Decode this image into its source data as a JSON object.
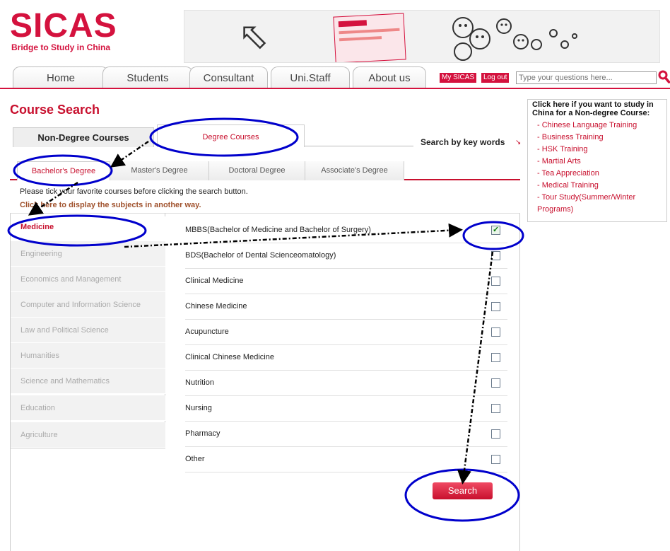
{
  "logo": {
    "name": "SICAS",
    "tagline": "Bridge to Study in China"
  },
  "colors": {
    "brand": "#d4123e",
    "accent": "#c8102e",
    "annotation": "#0000cc"
  },
  "nav": {
    "tabs": [
      "Home",
      "Students",
      "Consultant",
      "Uni.Staff",
      "About us"
    ],
    "my_sicas": "My SICAS",
    "log_out": "Log out",
    "search_placeholder": "Type your questions here...",
    "search_icon": "magnifier-icon"
  },
  "page_title": "Course Search",
  "course_tabs": {
    "non_degree": "Non-Degree Courses",
    "degree": "Degree Courses"
  },
  "search_by_keywords": "Search by key words",
  "degree_tabs": [
    "Bachelor's Degree",
    "Master's Degree",
    "Doctoral Degree",
    "Associate's Degree"
  ],
  "instructions": "Please tick your favorite courses before clicking the search button.",
  "click_here": "Click here to display the subjects in another way.",
  "subjects": [
    "Medicine",
    "Engineering",
    "Economics and Management",
    "Computer and Information Science",
    "Law and Political Science",
    "Humanities",
    "Science and Mathematics",
    "Education",
    "Agriculture"
  ],
  "courses": [
    {
      "label": "MBBS(Bachelor of Medicine and Bachelor of Surgery)",
      "checked": true
    },
    {
      "label": "BDS(Bachelor of Dental Scienceomatology)",
      "checked": false
    },
    {
      "label": "Clinical Medicine",
      "checked": false
    },
    {
      "label": "Chinese Medicine",
      "checked": false
    },
    {
      "label": "Acupuncture",
      "checked": false
    },
    {
      "label": "Clinical Chinese Medicine",
      "checked": false
    },
    {
      "label": "Nutrition",
      "checked": false
    },
    {
      "label": "Nursing",
      "checked": false
    },
    {
      "label": "Pharmacy",
      "checked": false
    },
    {
      "label": "Other",
      "checked": false
    }
  ],
  "search_button": "Search",
  "side": {
    "title": "Click here if you want to study in China for a Non-degree Course:",
    "items": [
      "Chinese Language Training",
      "Business Training",
      "HSK Training",
      "Martial Arts",
      "Tea Appreciation",
      "Medical Training",
      "Tour Study(Summer/Winter Programs)"
    ]
  }
}
